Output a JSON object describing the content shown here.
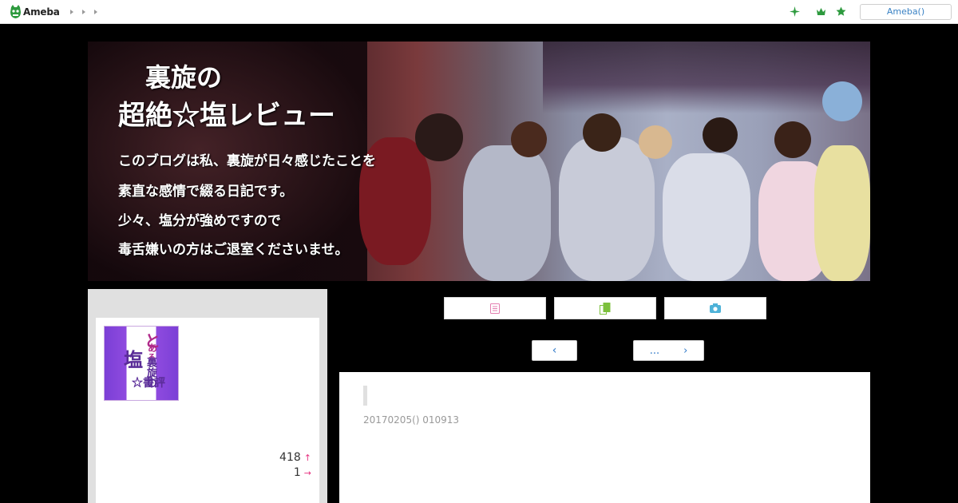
{
  "topbar": {
    "logo_text": "Ameba",
    "login_label": "Ameba()",
    "icons": [
      "sparkle-icon",
      "crown-icon",
      "star-icon"
    ],
    "accent_color": "#2d9a3e"
  },
  "banner": {
    "title_line1": "裏旋の",
    "title_line2": "超絶☆塩レビュー",
    "lines": [
      "このブログは私、裏旋が日々感じたことを",
      "素直な感情で綴る日記です。",
      "少々、塩分が強めですので",
      "毒舌嫌いの方はご退室くださいませ。"
    ]
  },
  "sidebar": {
    "avatar_text": {
      "a": "と",
      "b": "あ",
      "c": "る",
      "d": "塩",
      "e": "裏旋の",
      "f": "☆書評"
    },
    "stats": [
      {
        "value": "418",
        "arrow": "↑"
      },
      {
        "value": "1",
        "arrow": "→"
      }
    ]
  },
  "tabs": [
    {
      "icon": "list-icon",
      "color": "#e37fb0"
    },
    {
      "icon": "copy-icon",
      "color": "#7cc03c"
    },
    {
      "icon": "camera-icon",
      "color": "#4eb2d8"
    }
  ],
  "pager": {
    "prev_symbol": "‹",
    "next_ellipsis": "...",
    "next_symbol": "›"
  },
  "article": {
    "date": "20170205() 010913"
  }
}
